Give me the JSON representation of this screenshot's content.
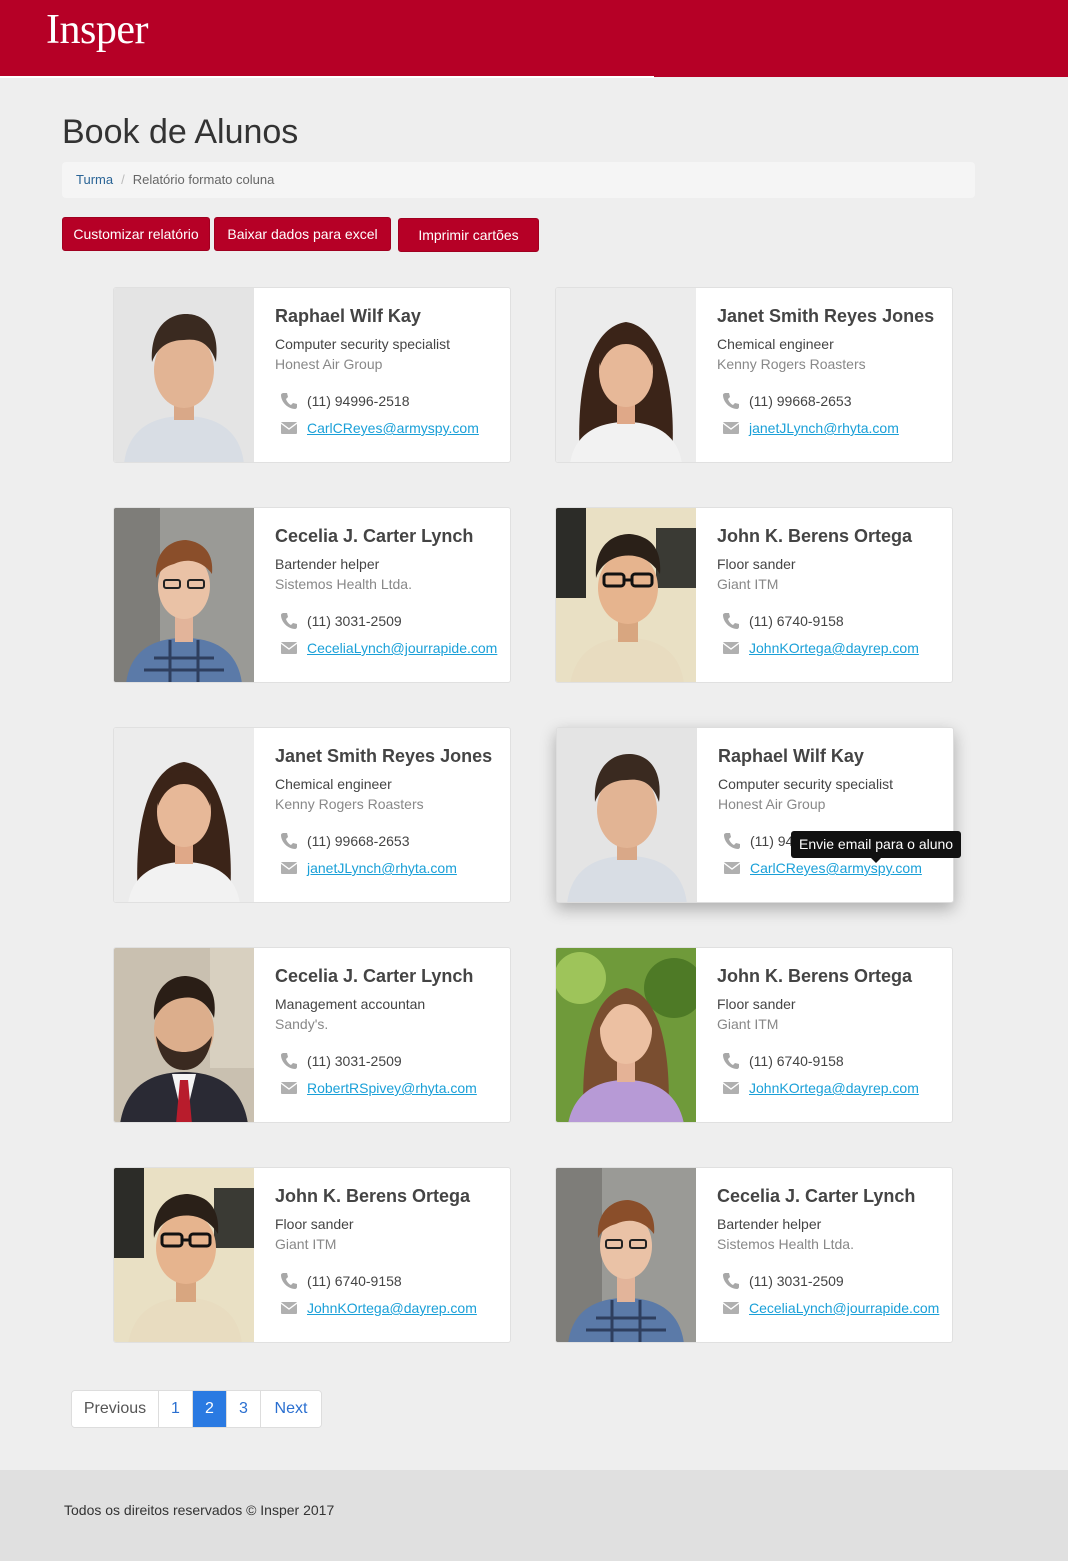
{
  "header": {
    "logo_text": "Insper",
    "brand_color": "#b60026"
  },
  "page": {
    "title": "Book de Alunos"
  },
  "breadcrumb": {
    "root": "Turma",
    "separator": "/",
    "current": "Relatório formato coluna"
  },
  "actions": {
    "customize": "Customizar relatório",
    "export_excel": "Baixar dados para excel",
    "print_cards": "Imprimir cartões"
  },
  "icons": {
    "phone": "phone-icon",
    "email": "envelope-icon"
  },
  "students": [
    {
      "name": "Raphael Wilf Kay",
      "job": "Computer security specialist",
      "company": "Honest Air Group",
      "phone": "(11) 94996-2518",
      "email": "CarlCReyes@armyspy.com"
    },
    {
      "name": "Janet Smith Reyes Jones",
      "job": "Chemical engineer",
      "company": "Kenny Rogers Roasters",
      "phone": "(11)  99668-2653",
      "email": "janetJLynch@rhyta.com"
    },
    {
      "name": "Cecelia J. Carter Lynch",
      "job": "Bartender helper",
      "company": "Sistemos Health Ltda.",
      "phone": "(11) 3031-2509",
      "email": "CeceliaLynch@jourrapide.com"
    },
    {
      "name": "John K. Berens Ortega",
      "job": "Floor sander",
      "company": "Giant ITM",
      "phone": "(11) 6740-9158",
      "email": "JohnKOrtega@dayrep.com"
    },
    {
      "name": "Janet Smith Reyes Jones",
      "job": "Chemical engineer",
      "company": "Kenny Rogers Roasters",
      "phone": "(11)  99668-2653",
      "email": "janetJLynch@rhyta.com"
    },
    {
      "name": "Raphael Wilf Kay",
      "job": "Computer security specialist",
      "company": "Honest Air Group",
      "phone": "(11) 94996-2518",
      "email": "CarlCReyes@armyspy.com"
    },
    {
      "name": "Cecelia J. Carter Lynch",
      "job": "Management accountan",
      "company": "Sandy's.",
      "phone": "(11) 3031-2509",
      "email": "RobertRSpivey@rhyta.com"
    },
    {
      "name": "John K. Berens Ortega",
      "job": "Floor sander",
      "company": "Giant ITM",
      "phone": "(11) 6740-9158",
      "email": "JohnKOrtega@dayrep.com"
    },
    {
      "name": "John K. Berens Ortega",
      "job": "Floor sander",
      "company": "Giant ITM",
      "phone": "(11) 6740-9158",
      "email": "JohnKOrtega@dayrep.com"
    },
    {
      "name": "Cecelia J. Carter Lynch",
      "job": "Bartender helper",
      "company": "Sistemos Health Ltda.",
      "phone": "(11) 3031-2509",
      "email": "CeceliaLynch@jourrapide.com"
    }
  ],
  "tooltip": {
    "text": "Envie email para o aluno"
  },
  "pagination": {
    "previous": "Previous",
    "pages": [
      "1",
      "2",
      "3"
    ],
    "current": "2",
    "next": "Next"
  },
  "footer": {
    "copyright": "Todos os direitos reservados © Insper 2017"
  }
}
